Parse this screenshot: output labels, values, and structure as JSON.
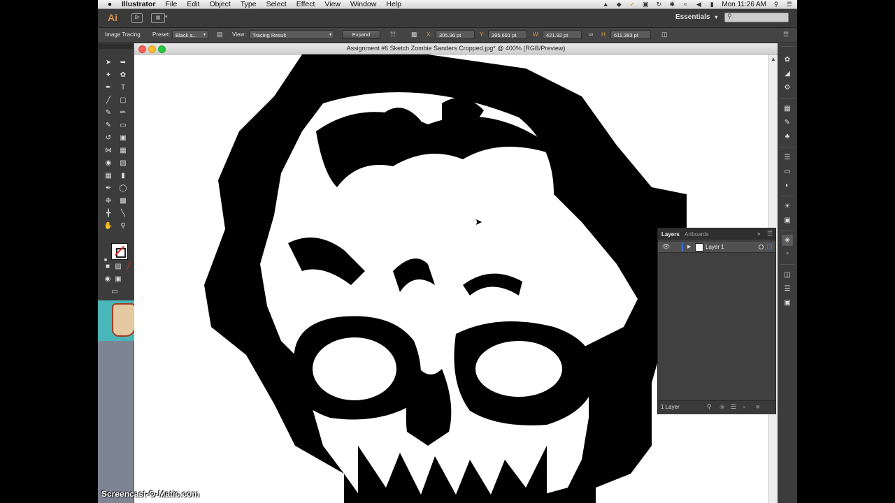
{
  "menubar": {
    "app_name": "Illustrator",
    "items": [
      "File",
      "Edit",
      "Object",
      "Type",
      "Select",
      "Effect",
      "View",
      "Window",
      "Help"
    ],
    "clock": "Mon 11:26 AM"
  },
  "appbar": {
    "logo": "Ai",
    "bridge_icon": "Br",
    "workspace": "Essentials",
    "workspace_caret": "▾"
  },
  "controlbar": {
    "mode_label": "Image Tracing",
    "preset_label": "Preset:",
    "preset_value": "Black a...",
    "view_label": "View:",
    "view_value": "Tracing Result",
    "expand_label": "Expand",
    "x_label": "X:",
    "x_value": "305.96 pt",
    "y_label": "Y:",
    "y_value": "395.691 pt",
    "w_label": "W:",
    "w_value": "421.92 pt",
    "h_label": "H:",
    "h_value": "611.383 pt"
  },
  "document": {
    "title": "Assignment #6 Sketch Zombie Sanders Cropped.jpg* @ 400% (RGB/Preview)"
  },
  "layers_panel": {
    "tab_layers": "Layers",
    "tab_artboards": "Artboards",
    "layer_name": "Layer 1",
    "footer_count": "1 Layer"
  },
  "watermark": "Screencast-O-Matic.com",
  "colors": {
    "ui_dark": "#3c3c3c",
    "ai_orange": "#d5924a",
    "selection_blue": "#3d6fd6"
  }
}
